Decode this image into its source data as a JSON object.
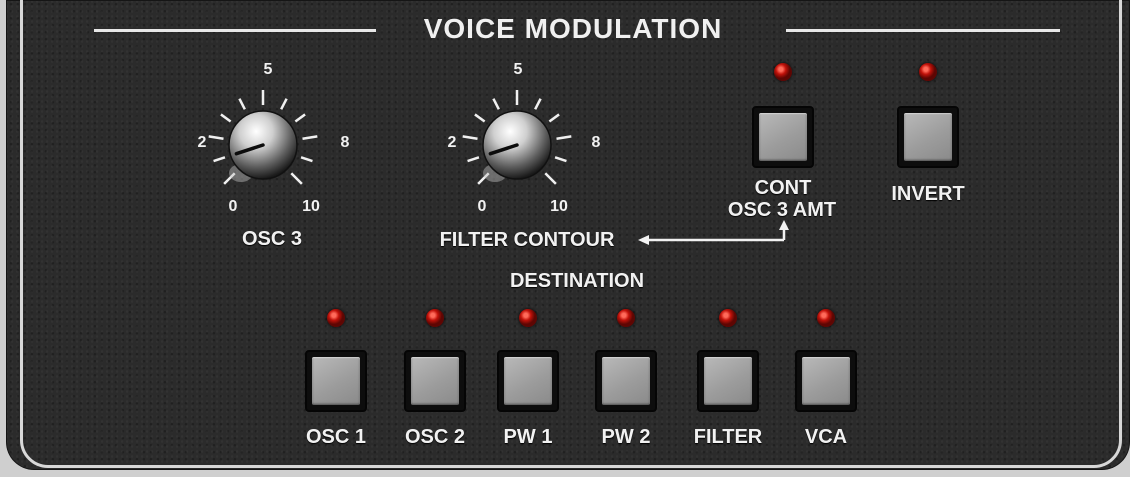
{
  "section_title": "VOICE MODULATION",
  "knobs": {
    "osc3": {
      "label": "OSC 3",
      "scale": {
        "min": "0",
        "low": "2",
        "mid": "5",
        "high": "8",
        "max": "10"
      },
      "value": 1
    },
    "filter_contour": {
      "label": "FILTER CONTOUR",
      "scale": {
        "min": "0",
        "low": "2",
        "mid": "5",
        "high": "8",
        "max": "10"
      },
      "value": 1
    }
  },
  "buttons": {
    "cont_osc3_amt": {
      "label_line1": "CONT",
      "label_line2": "OSC 3 AMT",
      "led_on": true
    },
    "invert": {
      "label": "INVERT",
      "led_on": true
    }
  },
  "destination": {
    "title": "DESTINATION",
    "items": [
      {
        "label": "OSC 1"
      },
      {
        "label": "OSC 2"
      },
      {
        "label": "PW 1"
      },
      {
        "label": "PW 2"
      },
      {
        "label": "FILTER"
      },
      {
        "label": "VCA"
      }
    ]
  },
  "colors": {
    "panel": "#2b2b2b",
    "led": "#c1120a",
    "button_face": "#a3a3a3",
    "text": "#f2f2f2"
  }
}
